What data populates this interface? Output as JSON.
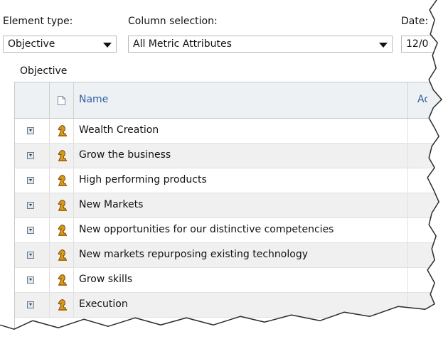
{
  "filters": {
    "element_type_label": "Element type:",
    "element_type_value": "Objective",
    "column_selection_label": "Column selection:",
    "column_selection_value": "All Metric Attributes",
    "date_label": "Date:",
    "date_value": "12/0"
  },
  "section": {
    "title": "Objective"
  },
  "grid": {
    "columns": {
      "name": "Name",
      "extra": "Ac"
    },
    "rows": [
      {
        "name": "Wealth Creation"
      },
      {
        "name": "Grow the business"
      },
      {
        "name": "High performing products"
      },
      {
        "name": "New Markets"
      },
      {
        "name": "New opportunities for our distinctive competencies"
      },
      {
        "name": "New markets repurposing existing technology"
      },
      {
        "name": "Grow skills"
      },
      {
        "name": "Execution"
      }
    ]
  },
  "colors": {
    "header_bg": "#eef1f4",
    "link_blue": "#2b5fa1",
    "alt_row": "#f0f0f0",
    "icon_gold": "#d89a1c"
  }
}
